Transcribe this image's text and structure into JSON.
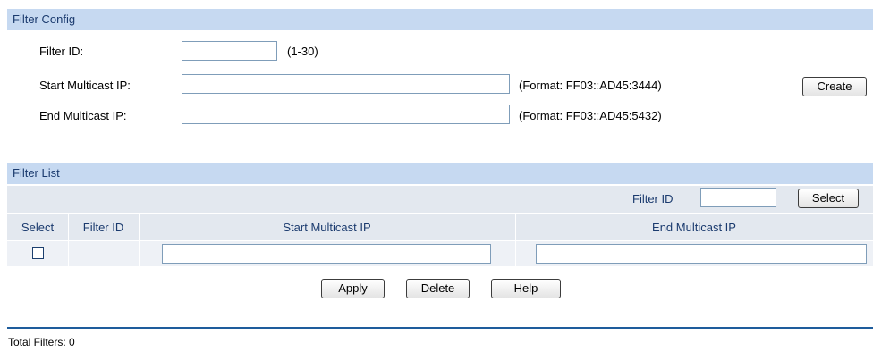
{
  "filter_config": {
    "header": "Filter Config",
    "filter_id": {
      "label": "Filter ID:",
      "value": "",
      "hint": "(1-30)"
    },
    "start_ip": {
      "label": "Start Multicast IP:",
      "value": "",
      "hint": "(Format: FF03::AD45:3444)"
    },
    "end_ip": {
      "label": "End Multicast IP:",
      "value": "",
      "hint": "(Format: FF03::AD45:5432)"
    },
    "create_label": "Create"
  },
  "filter_list": {
    "header": "Filter List",
    "search": {
      "label": "Filter ID",
      "value": "",
      "button": "Select"
    },
    "columns": [
      "Select",
      "Filter ID",
      "Start Multicast IP",
      "End Multicast IP"
    ],
    "edit_row": {
      "checked": false,
      "filter_id": "",
      "start_ip": "",
      "end_ip": ""
    },
    "buttons": {
      "apply": "Apply",
      "delete": "Delete",
      "help": "Help"
    }
  },
  "footer": {
    "total_filters": "Total Filters: 0"
  }
}
